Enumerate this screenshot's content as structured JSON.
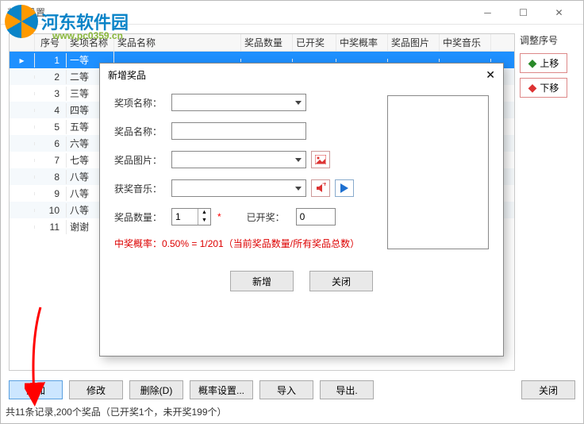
{
  "window": {
    "title": "奖品设置"
  },
  "watermark": {
    "name": "河东软件园",
    "url": "www.pc0359.cn"
  },
  "grid": {
    "headers": [
      "",
      "序号",
      "奖项名称",
      "奖品名称",
      "奖品数量",
      "已开奖",
      "中奖概率",
      "奖品图片",
      "中奖音乐"
    ],
    "rows": [
      {
        "num": "1",
        "award": "一等",
        "selected": true
      },
      {
        "num": "2",
        "award": "二等"
      },
      {
        "num": "3",
        "award": "三等"
      },
      {
        "num": "4",
        "award": "四等"
      },
      {
        "num": "5",
        "award": "五等"
      },
      {
        "num": "6",
        "award": "六等"
      },
      {
        "num": "7",
        "award": "七等"
      },
      {
        "num": "8",
        "award": "八等"
      },
      {
        "num": "9",
        "award": "八等"
      },
      {
        "num": "10",
        "award": "八等"
      },
      {
        "num": "11",
        "award": "谢谢"
      }
    ]
  },
  "side": {
    "label": "调整序号",
    "up": "上移",
    "down": "下移"
  },
  "buttons": {
    "add": "添加",
    "edit": "修改",
    "delete": "删除(D)",
    "prob": "概率设置...",
    "import": "导入",
    "export": "导出.",
    "close": "关闭"
  },
  "status": "共11条记录,200个奖品（已开奖1个，未开奖199个）",
  "dialog": {
    "title": "新增奖品",
    "labels": {
      "award_name": "奖项名称：",
      "prize_name": "奖品名称：",
      "prize_image": "奖品图片：",
      "prize_music": "获奖音乐：",
      "prize_qty": "奖品数量：",
      "already": "已开奖："
    },
    "values": {
      "award_name": "",
      "prize_name": "",
      "prize_image": "",
      "prize_music": "",
      "qty": "1",
      "already": "0"
    },
    "prob": "中奖概率：0.50% = 1/201（当前奖品数量/所有奖品总数）",
    "btn_add": "新增",
    "btn_close": "关闭"
  }
}
